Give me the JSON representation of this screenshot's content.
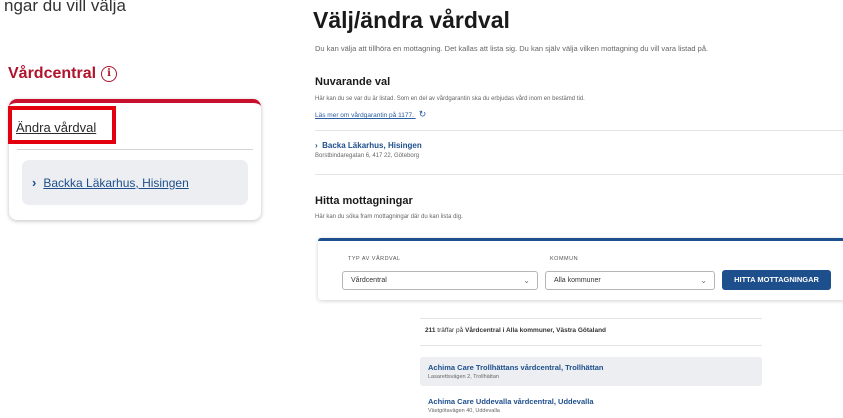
{
  "top_cut_text": "ngar du vill välja",
  "left": {
    "heading": "Vårdcentral",
    "info_icon": "i",
    "change_link": "Ändra vårdval",
    "clinic": "Backka Läkarhus, Hisingen"
  },
  "right": {
    "title": "Välj/ändra vårdval",
    "intro": "Du kan välja att tillhöra en mottagning. Det kallas att lista sig. Du kan själv välja vilken mottagning du vill vara listad på.",
    "current": {
      "heading": "Nuvarande val",
      "desc": "Här kan du se var du är listad. Som en del av vårdgarantin ska du erbjudas vård inom en bestämd tid.",
      "more_link": "Läs mer om vårdgarantin på 1177.",
      "clinic": "Backa Läkarhus, Hisingen",
      "address": "Borstbindaregatan 6, 417 22, Göteborg"
    },
    "find": {
      "heading": "Hitta mottagningar",
      "desc": "Här kan du söka fram mottagningar där du kan lista dig.",
      "type_label": "TYP AV VÅRDVAL",
      "type_value": "Vårdcentral",
      "kommun_label": "KOMMUN",
      "kommun_value": "Alla kommuner",
      "button": "HITTA MOTTAGNINGAR"
    },
    "results": {
      "count": "211",
      "text_before": " träffar på ",
      "filter": "Vårdcentral i Alla kommuner, Västra Götaland",
      "items": [
        {
          "name": "Achima Care Trollhättans vårdcentral, Trollhättan",
          "address": "Lasarettsvägen 2, Trollhättan"
        },
        {
          "name": "Achima Care Uddevalla vårdcentral, Uddevalla",
          "address": "Västgötavägen 40, Uddevalla"
        }
      ]
    }
  },
  "colors": {
    "brand_red": "#c8102e",
    "highlight_red": "#e3000f",
    "link_blue": "#1d4f8c"
  }
}
